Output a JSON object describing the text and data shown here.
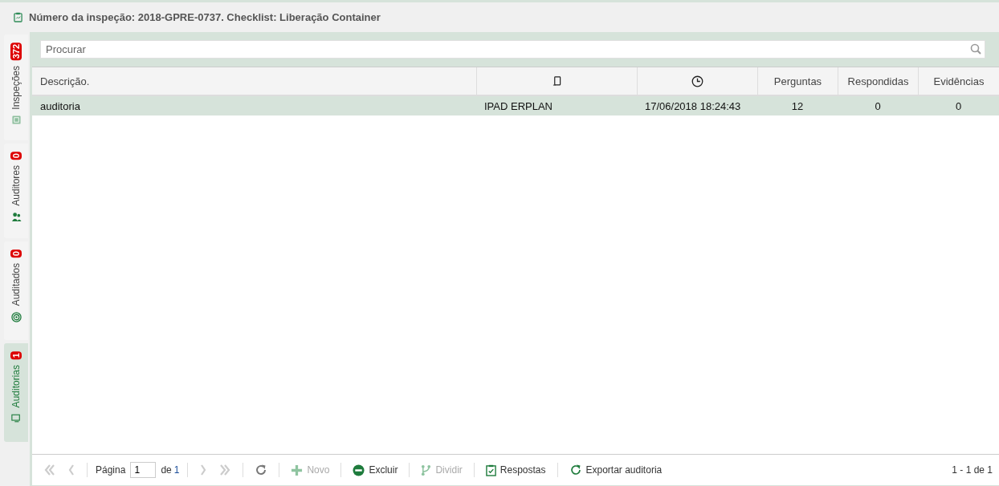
{
  "header": {
    "title": "Número da inspeção: 2018-GPRE-0737. Checklist: Liberação Container"
  },
  "tabs": [
    {
      "label": "Inspeções",
      "count": "372",
      "selected": false
    },
    {
      "label": "Auditores",
      "count": "0",
      "selected": false
    },
    {
      "label": "Auditados",
      "count": "0",
      "selected": false
    },
    {
      "label": "Auditorias",
      "count": "1",
      "selected": true
    }
  ],
  "search": {
    "placeholder": "Procurar"
  },
  "table": {
    "columns": [
      {
        "kind": "text",
        "label": "Descrição."
      },
      {
        "kind": "device-icon"
      },
      {
        "kind": "clock-icon"
      },
      {
        "kind": "text",
        "label": "Perguntas"
      },
      {
        "kind": "text",
        "label": "Respondidas"
      },
      {
        "kind": "text",
        "label": "Evidências"
      }
    ],
    "rows": [
      {
        "selected": true,
        "cells": [
          "auditoria",
          "IPAD ERPLAN",
          "17/06/2018 18:24:43",
          "12",
          "0",
          "0"
        ]
      }
    ]
  },
  "pager": {
    "page_label": "Página",
    "page": "1",
    "of_label": "de",
    "page_count": "1",
    "summary": "1 - 1 de 1"
  },
  "toolbar": [
    {
      "kind": "refresh",
      "disabled": false
    },
    {
      "kind": "add",
      "label": "Novo",
      "disabled": true
    },
    {
      "kind": "delete",
      "label": "Excluir",
      "disabled": false
    },
    {
      "kind": "split",
      "label": "Dividir",
      "disabled": true
    },
    {
      "kind": "answers",
      "label": "Respostas",
      "disabled": false
    },
    {
      "kind": "export",
      "label": "Exportar auditoria",
      "disabled": false
    }
  ],
  "nav": {
    "first_disabled": true,
    "prev_disabled": true,
    "next_disabled": true,
    "last_disabled": true
  }
}
